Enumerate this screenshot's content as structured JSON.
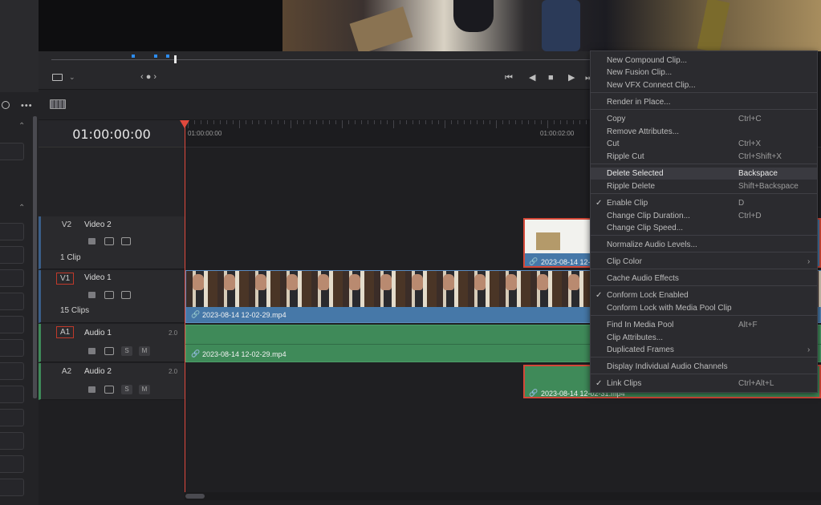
{
  "viewer": {
    "loop_icon": "crop-icon",
    "nav": "‹ ● ›"
  },
  "timeline": {
    "timecode": "01:00:00:00",
    "ruler_labels": [
      "01:00:00:00",
      "01:00:02:00"
    ],
    "tracks": [
      {
        "id": "V2",
        "name": "Video 2",
        "count": "1 Clip"
      },
      {
        "id": "V1",
        "name": "Video 1",
        "count": "15 Clips"
      },
      {
        "id": "A1",
        "name": "Audio 1",
        "channels": "2.0",
        "s": "S",
        "m": "M"
      },
      {
        "id": "A2",
        "name": "Audio 2",
        "channels": "2.0",
        "s": "S",
        "m": "M"
      }
    ],
    "clips": {
      "v2": "2023-08-14 12-0",
      "v1": "2023-08-14 12-02-29.mp4",
      "a1": "2023-08-14 12-02-29.mp4",
      "a2": "2023-08-14 12-02-31.mp4"
    }
  },
  "menu": {
    "items": [
      {
        "label": "New Compound Clip..."
      },
      {
        "label": "New Fusion Clip..."
      },
      {
        "label": "New VFX Connect Clip..."
      },
      {
        "label": "Render in Place..."
      },
      {
        "label": "Copy",
        "shortcut": "Ctrl+C"
      },
      {
        "label": "Remove Attributes..."
      },
      {
        "label": "Cut",
        "shortcut": "Ctrl+X"
      },
      {
        "label": "Ripple Cut",
        "shortcut": "Ctrl+Shift+X"
      },
      {
        "label": "Delete Selected",
        "shortcut": "Backspace",
        "highlighted": true
      },
      {
        "label": "Ripple Delete",
        "shortcut": "Shift+Backspace"
      },
      {
        "label": "Enable Clip",
        "shortcut": "D",
        "checked": true
      },
      {
        "label": "Change Clip Duration...",
        "shortcut": "Ctrl+D"
      },
      {
        "label": "Change Clip Speed..."
      },
      {
        "label": "Normalize Audio Levels..."
      },
      {
        "label": "Clip Color",
        "submenu": true
      },
      {
        "label": "Cache Audio Effects"
      },
      {
        "label": "Conform Lock Enabled",
        "checked": true
      },
      {
        "label": "Conform Lock with Media Pool Clip"
      },
      {
        "label": "Find In Media Pool",
        "shortcut": "Alt+F"
      },
      {
        "label": "Clip Attributes..."
      },
      {
        "label": "Duplicated Frames",
        "submenu": true
      },
      {
        "label": "Display Individual Audio Channels"
      },
      {
        "label": "Link Clips",
        "shortcut": "Ctrl+Alt+L",
        "checked": true
      }
    ],
    "check_glyph": "✓",
    "arrow_glyph": "›"
  },
  "colors": {
    "accent_red": "#e0493d",
    "video_clip": "#4678a8",
    "audio_clip": "#3f8a59",
    "menu_bg": "#2b2b2f"
  }
}
